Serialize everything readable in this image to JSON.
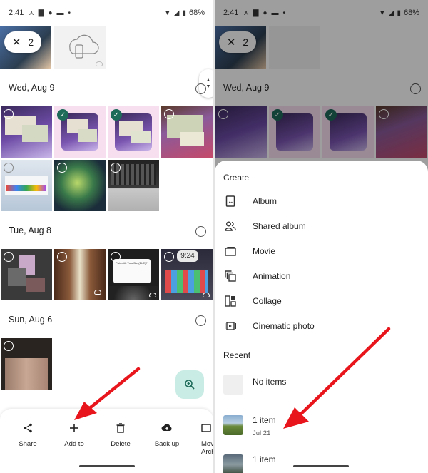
{
  "status": {
    "time": "2:41",
    "battery": "68%"
  },
  "selection": {
    "count": "2"
  },
  "sections": [
    {
      "date": "Wed, Aug 9"
    },
    {
      "date": "Tue, Aug 8"
    },
    {
      "date": "Sun, Aug 6"
    }
  ],
  "phone_clock": "9:24",
  "dialog_thumb_title": "Pair with Tuto Box(BLE)?",
  "actions": [
    {
      "label": "Share",
      "icon": "share-icon"
    },
    {
      "label": "Add to",
      "icon": "plus-icon"
    },
    {
      "label": "Delete",
      "icon": "trash-icon"
    },
    {
      "label": "Back up",
      "icon": "cloud-upload-icon"
    },
    {
      "label": "Move\nArch",
      "icon": "archive-icon"
    }
  ],
  "sheet": {
    "create_heading": "Create",
    "create_items": [
      {
        "label": "Album",
        "icon": "album-icon"
      },
      {
        "label": "Shared album",
        "icon": "people-icon"
      },
      {
        "label": "Movie",
        "icon": "movie-icon"
      },
      {
        "label": "Animation",
        "icon": "animation-icon"
      },
      {
        "label": "Collage",
        "icon": "collage-icon"
      },
      {
        "label": "Cinematic photo",
        "icon": "cinematic-icon"
      }
    ],
    "recent_heading": "Recent",
    "recent_items": [
      {
        "title": "No items",
        "subtitle": ""
      },
      {
        "title": "1 item",
        "subtitle": "Jul 21"
      },
      {
        "title": "1 item",
        "subtitle": ""
      }
    ]
  },
  "colors": {
    "accent": "#1e6b5a",
    "fab_bg": "#c9ece4",
    "select_bg": "#f7dff0",
    "arrow": "#e8161c"
  }
}
